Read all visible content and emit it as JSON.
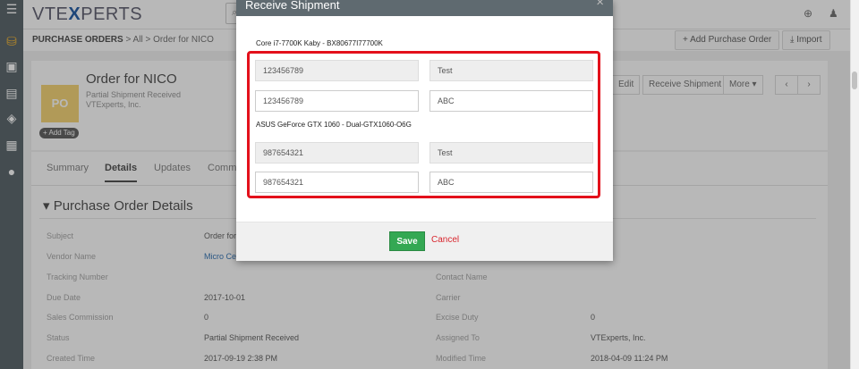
{
  "topbar": {
    "logo_pre": "VTE",
    "logo_x": "X",
    "logo_post": "PERTS",
    "search_icon": "search-icon",
    "plus_icon": "plus-circle-icon",
    "user_icon": "user-icon"
  },
  "sidebar": {
    "icons": [
      "menu-icon",
      "sales-icon",
      "inventory-icon",
      "calculator-icon",
      "support-icon",
      "building-icon",
      "contacts-icon"
    ]
  },
  "breadcrumb": {
    "module": "Purchase Orders",
    "sep1": ">",
    "all": "All",
    "sep2": ">",
    "record": "Order for NICO"
  },
  "header_buttons": {
    "add": "+ Add Purchase Order",
    "import": "Import"
  },
  "record": {
    "icon_label": "PO",
    "title": "Order for NICO",
    "status": "Partial Shipment Received",
    "org": "VTExperts, Inc.",
    "add_tag": "+ Add Tag"
  },
  "actions": {
    "edit": "Edit",
    "receive": "Receive Shipment",
    "more": "More ▾",
    "prev": "‹",
    "next": "›"
  },
  "tabs": [
    "Summary",
    "Details",
    "Updates",
    "Comm"
  ],
  "details": {
    "title": "Purchase Order Details",
    "fields": [
      {
        "label": "Subject",
        "value": "Order for"
      },
      {
        "label": "Vendor Name",
        "value": "Micro Cen"
      },
      {
        "label": "Tracking Number",
        "value": ""
      },
      {
        "label": "Due Date",
        "value": "2017-10-01"
      },
      {
        "label": "Sales Commission",
        "value": "0"
      },
      {
        "label": "Status",
        "value": "Partial Shipment Received"
      },
      {
        "label": "Created Time",
        "value": "2017-09-19 2:38 PM"
      }
    ],
    "right_fields": [
      {
        "label": "Contact Name",
        "value": ""
      },
      {
        "label": "Carrier",
        "value": ""
      },
      {
        "label": "Excise Duty",
        "value": "0"
      },
      {
        "label": "Assigned To",
        "value": "VTExperts, Inc."
      },
      {
        "label": "Modified Time",
        "value": "2018-04-09 11:24 PM"
      }
    ]
  },
  "modal": {
    "title": "Receive Shipment",
    "close": "×",
    "products": [
      {
        "name": "Core i7-7700K Kaby - BX80677I77700K",
        "serial_ro": "123456789",
        "note_ro": "Test",
        "serial": "123456789",
        "note": "ABC"
      },
      {
        "name": "ASUS GeForce GTX 1060 - Dual-GTX1060-O6G",
        "serial_ro": "987654321",
        "note_ro": "Test",
        "serial": "987654321",
        "note": "ABC"
      }
    ],
    "save": "Save",
    "cancel": "Cancel"
  },
  "colors": {
    "sidebar": "#5f6a70",
    "save": "#34a853",
    "highlight": "#e3101b",
    "cancel": "#d9262e"
  }
}
